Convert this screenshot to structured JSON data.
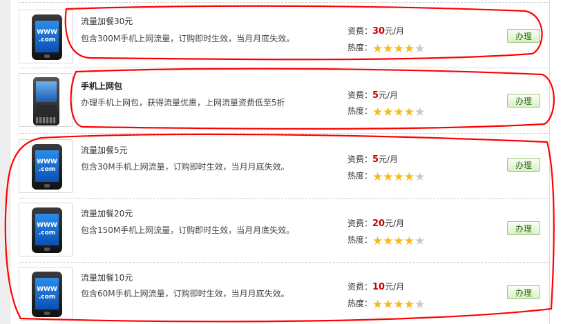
{
  "labels": {
    "fee": "资费：",
    "fee_unit": "元/月",
    "heat": "热度：",
    "apply": "办理"
  },
  "colors": {
    "price": "#cc0000",
    "star_on": "#f6b81c",
    "star_off": "#c7c7c7",
    "apply_border": "#9cc47a",
    "annotation": "#ff0000"
  },
  "icons": {
    "phone": "phone-www-icon",
    "pda": "pda-phone-icon"
  },
  "items": [
    {
      "icon": "phone",
      "screen_top": "WWW",
      "screen_bottom": ".com",
      "title": "流量加餐30元",
      "desc": "包含300M手机上网流量，订购即时生效，当月月底失效。",
      "price": "30",
      "rating": 4,
      "rating_max": 5
    },
    {
      "icon": "pda",
      "title": "手机上网包",
      "desc": "办理手机上网包，获得流量优惠，上网流量资费低至5折",
      "price": "5",
      "rating": 4,
      "rating_max": 5
    },
    {
      "icon": "phone",
      "screen_top": "WWW",
      "screen_bottom": ".com",
      "title": "流量加餐5元",
      "desc": "包含30M手机上网流量，订购即时生效，当月月底失效。",
      "price": "5",
      "rating": 4,
      "rating_max": 5
    },
    {
      "icon": "phone",
      "screen_top": "WWW",
      "screen_bottom": ".com",
      "title": "流量加餐20元",
      "desc": "包含150M手机上网流量，订购即时生效，当月月底失效。",
      "price": "20",
      "rating": 4,
      "rating_max": 5
    },
    {
      "icon": "phone",
      "screen_top": "WWW",
      "screen_bottom": ".com",
      "title": "流量加餐10元",
      "desc": "包含60M手机上网流量，订购即时生效，当月月底失效。",
      "price": "10",
      "rating": 4,
      "rating_max": 5
    }
  ]
}
